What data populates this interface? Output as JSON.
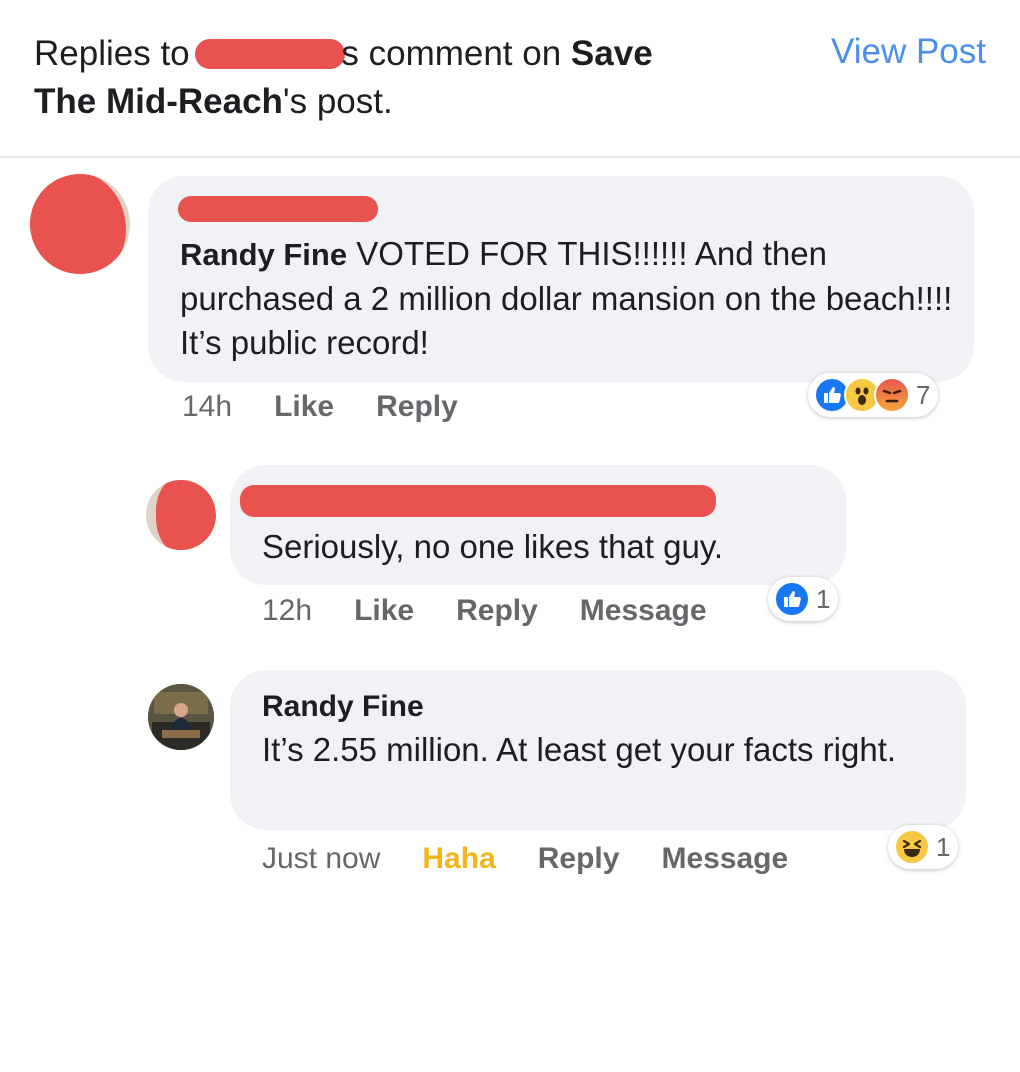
{
  "header": {
    "prefix": "Replies to ",
    "suffix": "s comment on ",
    "page_name_a": "Save",
    "page_name_b": "The Mid-Reach",
    "post_suffix": "'s post.",
    "view_post": "View Post"
  },
  "comments": [
    {
      "author": "Randy Fine",
      "text": " VOTED FOR THIS!!!!!! And then purchased a 2 million dollar mansion on the beach!!!! It’s public record!",
      "time": "14h",
      "like": "Like",
      "reply": "Reply",
      "reactions": [
        "like-icon",
        "wow-icon",
        "angry-icon"
      ],
      "reaction_count": "7"
    },
    {
      "text": "Seriously, no one likes that guy.",
      "time": "12h",
      "like": "Like",
      "reply": "Reply",
      "message": "Message",
      "reactions": [
        "like-icon"
      ],
      "reaction_count": "1"
    },
    {
      "author": "Randy Fine",
      "text": "It’s 2.55 million. At least get your facts right.",
      "time": "Just now",
      "haha": "Haha",
      "reply": "Reply",
      "message": "Message",
      "reactions": [
        "haha-icon"
      ],
      "reaction_count": "1"
    }
  ],
  "colors": {
    "link_blue": "#4b8ef0",
    "bubble_bg": "#f0f2f5",
    "haha_yellow": "#f2b51c",
    "redaction_red": "#e8524f"
  }
}
